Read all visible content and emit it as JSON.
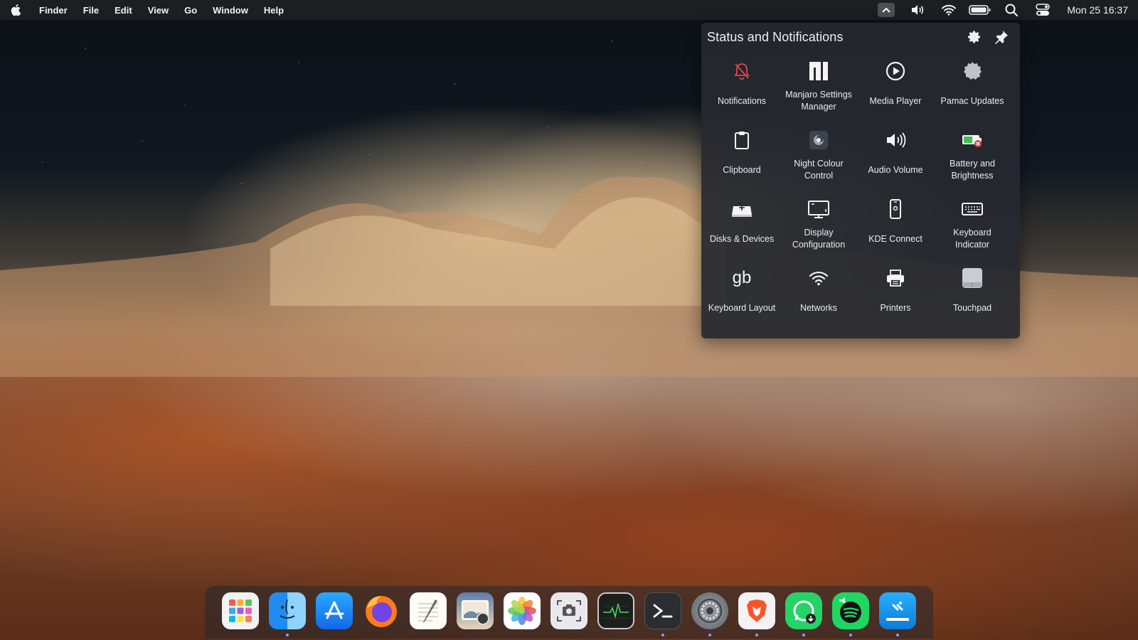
{
  "menubar": {
    "app_name": "Finder",
    "menus": [
      "File",
      "Edit",
      "View",
      "Go",
      "Window",
      "Help"
    ],
    "clock": "Mon 25 16:37",
    "tray_icons": [
      "tray-expand-icon",
      "volume-icon",
      "wifi-icon",
      "battery-icon",
      "search-icon",
      "control-center-icon"
    ]
  },
  "popup": {
    "title": "Status and Notifications",
    "items": [
      {
        "label": "Notifications",
        "icon": "bell-off-icon"
      },
      {
        "label": "Manjaro Settings Manager",
        "icon": "manjaro-logo-icon"
      },
      {
        "label": "Media Player",
        "icon": "play-circle-icon"
      },
      {
        "label": "Pamac Updates",
        "icon": "pamac-badge-icon"
      },
      {
        "label": "Clipboard",
        "icon": "clipboard-icon"
      },
      {
        "label": "Night Colour Control",
        "icon": "night-colour-icon"
      },
      {
        "label": "Audio Volume",
        "icon": "speaker-icon"
      },
      {
        "label": "Battery and Brightness",
        "icon": "battery-warning-icon"
      },
      {
        "label": "Disks & Devices",
        "icon": "usb-drive-icon"
      },
      {
        "label": "Display Configuration",
        "icon": "monitor-icon"
      },
      {
        "label": "KDE Connect",
        "icon": "phone-icon"
      },
      {
        "label": "Keyboard Indicator",
        "icon": "keyboard-icon"
      },
      {
        "label": "Keyboard Layout",
        "icon": "keyboard-layout-gb-icon",
        "glyph": "gb"
      },
      {
        "label": "Networks",
        "icon": "wifi-icon"
      },
      {
        "label": "Printers",
        "icon": "printer-icon"
      },
      {
        "label": "Touchpad",
        "icon": "touchpad-icon"
      }
    ]
  },
  "dock": {
    "apps": [
      {
        "name": "launchpad",
        "running": false
      },
      {
        "name": "finder",
        "running": true
      },
      {
        "name": "app-store",
        "running": false
      },
      {
        "name": "firefox",
        "running": false
      },
      {
        "name": "text-editor",
        "running": false
      },
      {
        "name": "preview",
        "running": false
      },
      {
        "name": "photos",
        "running": false
      },
      {
        "name": "screenshot",
        "running": false
      },
      {
        "name": "activity-monitor",
        "running": false
      },
      {
        "name": "terminal",
        "running": true
      },
      {
        "name": "system-settings",
        "running": true
      },
      {
        "name": "brave",
        "running": true
      },
      {
        "name": "whatsapp",
        "running": true
      },
      {
        "name": "spotify",
        "running": true
      },
      {
        "name": "remote-desktop",
        "running": true
      }
    ]
  },
  "colors": {
    "accent": "#7fa4ff",
    "popup_bg": "#26292f",
    "notification_off": "#e0484b"
  }
}
